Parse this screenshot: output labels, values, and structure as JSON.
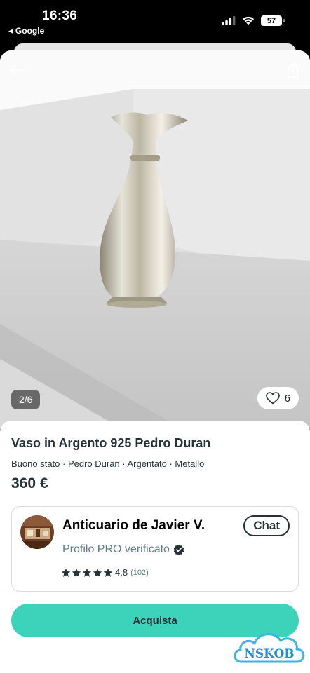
{
  "status_bar": {
    "time": "16:36",
    "back_app": "Google",
    "battery": "57"
  },
  "gallery": {
    "page_indicator": "2/6",
    "likes": "6"
  },
  "product": {
    "title": "Vaso in Argento 925 Pedro Duran",
    "attributes": "Buono stato · Pedro Duran · Argentato · Metallo",
    "price": "360 €"
  },
  "seller": {
    "name": "Anticuario de Javier  V.",
    "chat_label": "Chat",
    "badge_text": "Profilo PRO verificato",
    "rating": 4.8,
    "rating_text": "4,8",
    "review_count": "(102)",
    "stars_filled": 5
  },
  "action": {
    "buy_label": "Acquista"
  },
  "watermark": {
    "text": "NSKOB"
  },
  "colors": {
    "accent": "#3dd2ba",
    "text_dark": "#253238",
    "text_muted": "#607d8b"
  }
}
